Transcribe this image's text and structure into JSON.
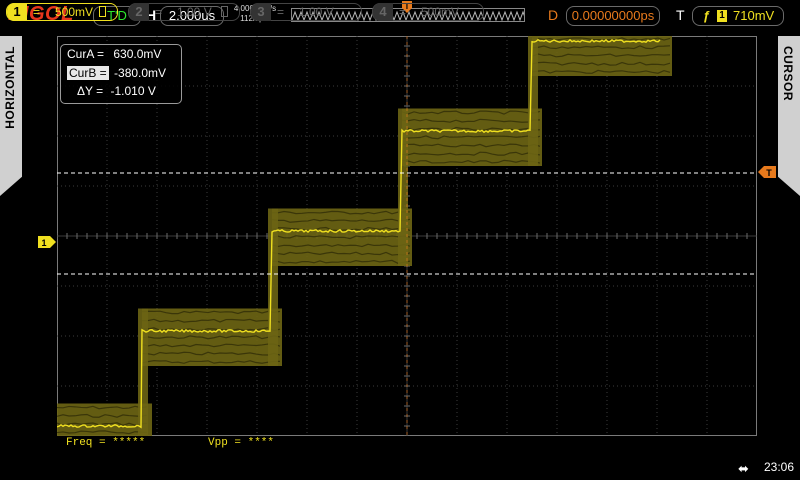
{
  "brand": "RIGOL",
  "top": {
    "run_status": "T'D",
    "h_label": "H",
    "timebase": "2.000us",
    "sample_rate": "4.000GSa/s",
    "memory_depth": "112k pts",
    "d_label": "D",
    "delay": "0.00000000ps",
    "t_label": "T",
    "trigger_edge": "ƒ",
    "trigger_source": "1",
    "trigger_level": "710mV",
    "trigger_marker": "T"
  },
  "side": {
    "left_tab": "HORIZONTAL",
    "right_tab": "CURSOR"
  },
  "cursor": {
    "cura_label": "CurA =",
    "cura_value": "630.0mV",
    "curb_label": "CurB =",
    "curb_value": "-380.0mV",
    "dy_label": "ΔY =",
    "dy_value": "-1.010 V"
  },
  "markers": {
    "ch1_ground": "1",
    "trigger_level_marker": "T"
  },
  "measurements": {
    "freq": "Freq = *****",
    "vpp": "Vpp = ****"
  },
  "channels": [
    {
      "num": "1",
      "coupling": "=",
      "scale": "500mV",
      "active": true
    },
    {
      "num": "2",
      "coupling": "=",
      "scale": "1.00 V",
      "active": false
    },
    {
      "num": "3",
      "coupling": "=",
      "scale": "1.00 V",
      "active": false
    },
    {
      "num": "4",
      "coupling": "=",
      "scale": "500mV",
      "active": false
    }
  ],
  "status": {
    "usb_icon": "usb-icon",
    "time": "23:06"
  },
  "colors": {
    "ch1": "#f0e020",
    "persistence": "#6b6414",
    "trigger": "#e87a1c",
    "brand": "#e8361c",
    "run": "#2ee82e"
  },
  "waveform": {
    "steps_volts": [
      -1.9,
      -0.95,
      0.05,
      1.05,
      1.95
    ],
    "noise_band_volts": 0.5
  }
}
